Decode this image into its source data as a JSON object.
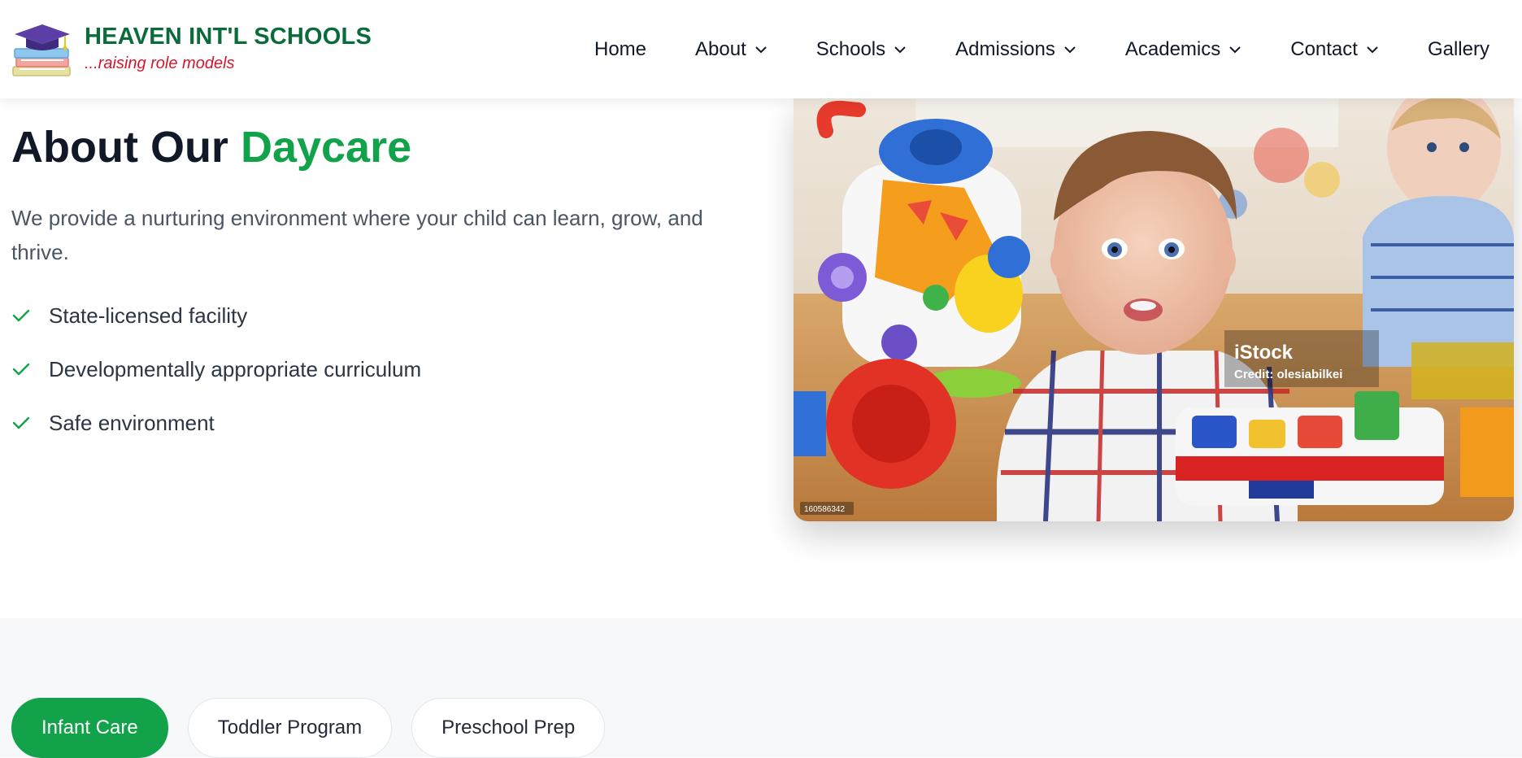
{
  "brand": {
    "title": "HEAVEN INT'L SCHOOLS",
    "tagline": "...raising role models",
    "logo_icon": "graduation-cap-books-icon"
  },
  "nav": {
    "items": [
      {
        "label": "Home",
        "has_dropdown": false
      },
      {
        "label": "About",
        "has_dropdown": true
      },
      {
        "label": "Schools",
        "has_dropdown": true
      },
      {
        "label": "Admissions",
        "has_dropdown": true
      },
      {
        "label": "Academics",
        "has_dropdown": true
      },
      {
        "label": "Contact",
        "has_dropdown": true
      },
      {
        "label": "Gallery",
        "has_dropdown": false
      }
    ],
    "dropdown_icon": "chevron-down-icon"
  },
  "hero": {
    "title_prefix": "About Our ",
    "title_accent": "Daycare",
    "description": "We provide a nurturing environment where your child can learn, grow, and thrive.",
    "features": [
      "State-licensed facility",
      "Developmentally appropriate curriculum",
      "Safe environment"
    ],
    "feature_icon": "check-icon"
  },
  "photo": {
    "watermark_brand": "iStock",
    "watermark_credit": "Credit: olesiabilkei",
    "stock_id": "160586342"
  },
  "program_tabs": {
    "items": [
      {
        "label": "Infant Care",
        "active": true
      },
      {
        "label": "Toddler Program",
        "active": false
      },
      {
        "label": "Preschool Prep",
        "active": false
      }
    ]
  },
  "colors": {
    "brand_green": "#0b6b3a",
    "accent_green": "#12a24a",
    "tagline_red": "#d4162c",
    "text_dark": "#111827",
    "text_muted": "#4b5563"
  }
}
